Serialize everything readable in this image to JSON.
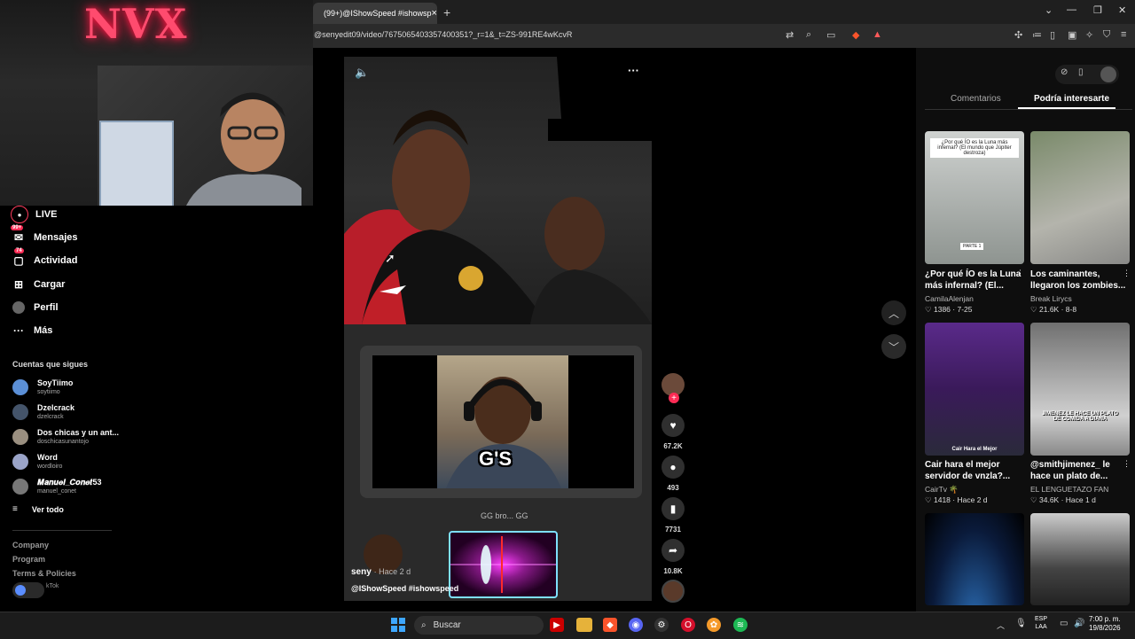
{
  "overlay": {
    "neon_text": "NVX"
  },
  "browser": {
    "tab_title": "(99+)@IShowSpeed #ishowsp",
    "tab_close": "×",
    "new_tab": "+",
    "url": "@senyedit09/video/7675065403357400351?_r=1&_t=ZS-991RE4wKcvR"
  },
  "sidebar": {
    "items": [
      {
        "label": "LIVE",
        "icon": "live-icon"
      },
      {
        "label": "Mensajes",
        "icon": "messages-icon",
        "badge": "99+"
      },
      {
        "label": "Actividad",
        "icon": "activity-icon",
        "badge": "74"
      },
      {
        "label": "Cargar",
        "icon": "upload-icon"
      },
      {
        "label": "Perfil",
        "icon": "profile-icon"
      },
      {
        "label": "Más",
        "icon": "more-icon"
      }
    ],
    "following_title": "Cuentas que sigues",
    "following": [
      {
        "name": "SoyTiimo",
        "user": "soytiimo",
        "color": "#5b8fd6"
      },
      {
        "name": "Dzelcrack",
        "user": "dzelcrack",
        "color": "#44546a"
      },
      {
        "name": "Dos chicas y un ant...",
        "user": "doschicasunantojo",
        "color": "#9a8f80"
      },
      {
        "name": "Word",
        "user": "wordloiro",
        "color": "#9aa4c8"
      },
      {
        "name": "𝑴𝒂𝒏𝒖𝒆𝒍_𝑪𝒐𝒏𝒆𝒕53",
        "user": "manuel_conet",
        "color": "#777"
      }
    ],
    "see_all": "Ver todo",
    "footer": [
      "Company",
      "Program",
      "Terms & Policies"
    ],
    "copyright": "kTok"
  },
  "video": {
    "caption_text": "G'S",
    "subtitle": "GG bro... GG",
    "author": "seny",
    "time": "· Hace 2 d",
    "description": "@IShowSpeed #ishowspeed"
  },
  "actions": {
    "likes": "67.2K",
    "comments": "493",
    "saves": "7731",
    "shares": "10.8K"
  },
  "panel": {
    "tabs": [
      "Comentarios",
      "Podría interesarte"
    ],
    "active_tab": 1,
    "cards": [
      {
        "title": "¿Por qué ÍO es la Luna más infernal? (El...",
        "author": "CamilaAlenjan",
        "likes": "1386",
        "date": "7-25",
        "thumb_text": "¿Por qué ÍO es la Luna más infernal? (El mundo que Júpiter destroza)",
        "thumb_tag": "PARTE 1"
      },
      {
        "title": "Los caminantes, llegaron los zombies...",
        "author": "Break Lirycs",
        "likes": "21.6K",
        "date": "8-8"
      },
      {
        "title": "Cair hara el mejor servidor de vnzla?...",
        "author": "CairTv 🌴",
        "likes": "1418",
        "date": "Hace 2 d",
        "thumb_text": "Cair Hara el Mejor"
      },
      {
        "title": "@smithjimenez_ le hace un plato de...",
        "author": "EL LENGUETAZO FAN",
        "likes": "34.6K",
        "date": "Hace 1 d",
        "thumb_text": "JIMENEZ LE HACE UN PLATO DE COMIDA A DIANA"
      }
    ]
  },
  "taskbar": {
    "search": "Buscar",
    "lang_top": "ESP",
    "lang_bottom": "LAA",
    "time": "7:00 p. m.",
    "date": "19/8/2026"
  }
}
